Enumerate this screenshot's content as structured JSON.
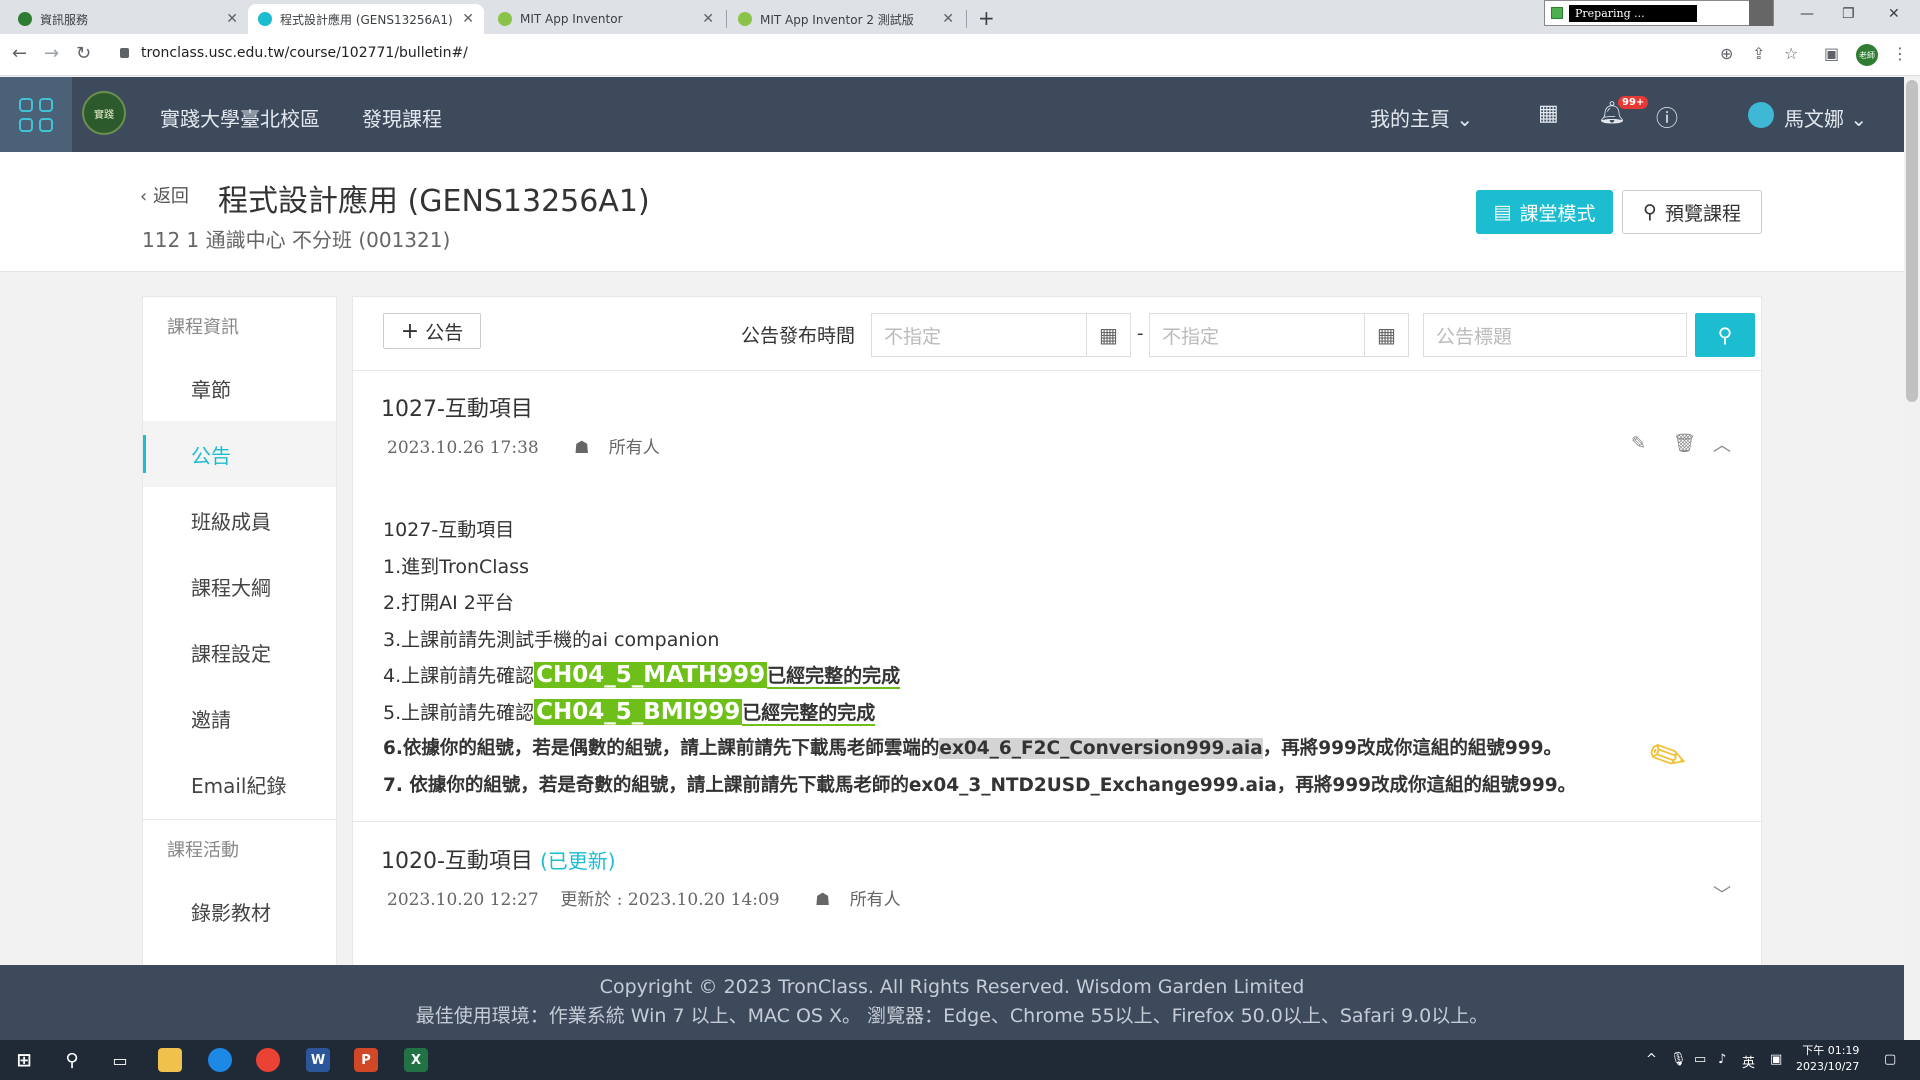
{
  "browser": {
    "tabs": [
      {
        "title": "資訊服務",
        "favicon_color": "#2e7d32"
      },
      {
        "title": "程式設計應用 (GENS13256A1)",
        "favicon_color": "#1cbdd0"
      },
      {
        "title": "MIT App Inventor",
        "favicon_color": "#8bc34a"
      },
      {
        "title": "MIT App Inventor 2 測試版",
        "favicon_color": "#8bc34a"
      }
    ],
    "recording_text": "Preparing ...",
    "url": "tronclass.usc.edu.tw/course/102771/bulletin#/",
    "profile_text": "老師"
  },
  "header": {
    "logo_text": "實踐",
    "nav": [
      "實踐大學臺北校區",
      "發現課程"
    ],
    "my_home": "我的主頁",
    "notif_badge": "99+",
    "user_name": "馬文娜"
  },
  "course": {
    "back": "返回",
    "title": "程式設計應用 (GENS13256A1)",
    "subtitle": "112 1 通識中心 不分班 (001321)",
    "classroom_mode": "課堂模式",
    "preview": "預覽課程"
  },
  "sidebar": {
    "section1": "課程資訊",
    "items": [
      "章節",
      "公告",
      "班級成員",
      "課程大綱",
      "課程設定",
      "邀請",
      "Email紀錄"
    ],
    "section2": "課程活動",
    "items2": [
      "錄影教材"
    ]
  },
  "toolbar": {
    "add_label": "公告",
    "filter_label": "公告發布時間",
    "date_from_placeholder": "不指定",
    "date_to_placeholder": "不指定",
    "dash": "-",
    "title_placeholder": "公告標題"
  },
  "posts": [
    {
      "title": "1027-互動項目",
      "date": "2023.10.26 17:38",
      "audience": "所有人",
      "lines": {
        "l1": "1027-互動項目",
        "l2": "1.進到TronClass",
        "l3": "2.打開AI 2平台",
        "l4": "3.上課前請先測試手機的ai companion",
        "l5_pre": "4.上課前請先確認",
        "l5_hl": "CH04_5_MATH999",
        "l5_post": "已經完整的完成",
        "l6_pre": "5.上課前請先確認",
        "l6_hl": "CH04_5_BMI999",
        "l6_post": "已經完整的完成",
        "l7_pre": "6.依據你的組號，若是偶數的組號，請上課前請先下載馬老師雲端的",
        "l7_file": "ex04_6_F2C_Conversion999.aia",
        "l7_post": "，再將999改成你這組的組號999。",
        "l8": "7. 依據你的組號，若是奇數的組號，請上課前請先下載馬老師的ex04_3_NTD2USD_Exchange999.aia，再將999改成你這組的組號999。"
      }
    },
    {
      "title": "1020-互動項目",
      "updated": "(已更新)",
      "date": "2023.10.20 12:27",
      "updated_at": "更新於 : 2023.10.20 14:09",
      "audience": "所有人"
    }
  ],
  "footer": {
    "copyright": "Copyright © 2023 TronClass. All Rights Reserved. Wisdom Garden Limited",
    "env": "最佳使用環境：作業系統 Win 7 以上、MAC OS X。 瀏覽器：Edge、Chrome 55以上、Firefox 50.0以上、Safari 9.0以上。"
  },
  "taskbar": {
    "ime": "英",
    "time": "下午 01:19",
    "date": "2023/10/27"
  }
}
